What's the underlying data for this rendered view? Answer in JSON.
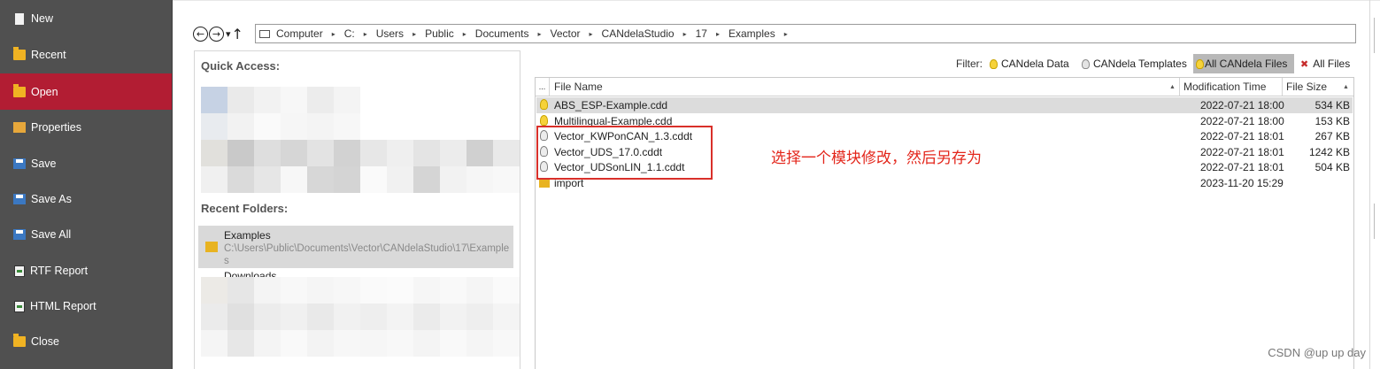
{
  "sidebar": {
    "items": [
      {
        "label": "New",
        "icon": "new-document-icon",
        "active": false
      },
      {
        "label": "Recent",
        "icon": "folder-icon",
        "active": false
      },
      {
        "label": "Open",
        "icon": "open-folder-icon",
        "active": true
      },
      {
        "label": "Properties",
        "icon": "properties-icon",
        "active": false
      },
      {
        "label": "Save",
        "icon": "save-icon",
        "active": false
      },
      {
        "label": "Save As",
        "icon": "save-as-icon",
        "active": false
      },
      {
        "label": "Save All",
        "icon": "save-all-icon",
        "active": false
      },
      {
        "label": "RTF Report",
        "icon": "rtf-report-icon",
        "active": false
      },
      {
        "label": "HTML Report",
        "icon": "html-report-icon",
        "active": false
      },
      {
        "label": "Close",
        "icon": "close-folder-icon",
        "active": false
      }
    ],
    "active_color": "#b21d33",
    "background_color": "#505050"
  },
  "navigation": {
    "back_glyph": "←",
    "forward_glyph": "→",
    "dropdown_glyph": "▾",
    "up_glyph": "↑",
    "breadcrumb": [
      "Computer",
      "C:",
      "Users",
      "Public",
      "Documents",
      "Vector",
      "CANdelaStudio",
      "17",
      "Examples"
    ],
    "separator": "▸"
  },
  "quick_access": {
    "title": "Quick Access:"
  },
  "recent_folders": {
    "title": "Recent Folders:",
    "items": [
      {
        "name": "Examples",
        "path": "C:\\Users\\Public\\Documents\\Vector\\CANdelaStudio\\17\\Examples"
      }
    ],
    "partial_next": "Downloads"
  },
  "filter": {
    "label": "Filter:",
    "options": [
      {
        "label": "CANdela Data",
        "icon": "bulb-yellow-icon",
        "active": false
      },
      {
        "label": "CANdela Templates",
        "icon": "bulb-white-icon",
        "active": false
      },
      {
        "label": "All CANdela Files",
        "icon": "bulb-multi-icon",
        "active": true
      },
      {
        "label": "All Files",
        "icon": "clear-filter-icon",
        "active": false
      }
    ]
  },
  "file_grid": {
    "columns": {
      "expander": "...",
      "name": "File Name",
      "time": "Modification Time",
      "size": "File Size"
    },
    "rows": [
      {
        "name": "ABS_ESP-Example.cdd",
        "time": "2022-07-21 18:00",
        "size": "534 KB",
        "icon": "bulb-yellow-icon",
        "selected": true
      },
      {
        "name": "Multilingual-Example.cdd",
        "time": "2022-07-21 18:00",
        "size": "153 KB",
        "icon": "bulb-yellow-icon",
        "selected": false
      },
      {
        "name": "Vector_KWPonCAN_1.3.cddt",
        "time": "2022-07-21 18:01",
        "size": "267 KB",
        "icon": "bulb-white-icon",
        "selected": false
      },
      {
        "name": "Vector_UDS_17.0.cddt",
        "time": "2022-07-21 18:01",
        "size": "1242 KB",
        "icon": "bulb-white-icon",
        "selected": false
      },
      {
        "name": "Vector_UDSonLIN_1.1.cddt",
        "time": "2022-07-21 18:01",
        "size": "504 KB",
        "icon": "bulb-white-icon",
        "selected": false
      },
      {
        "name": "import",
        "time": "2023-11-20 15:29",
        "size": "",
        "icon": "folder-icon",
        "selected": false
      }
    ]
  },
  "annotation": {
    "text": "选择一个模块修改，然后另存为",
    "color": "#e3261b"
  },
  "watermark": "CSDN @up up day"
}
